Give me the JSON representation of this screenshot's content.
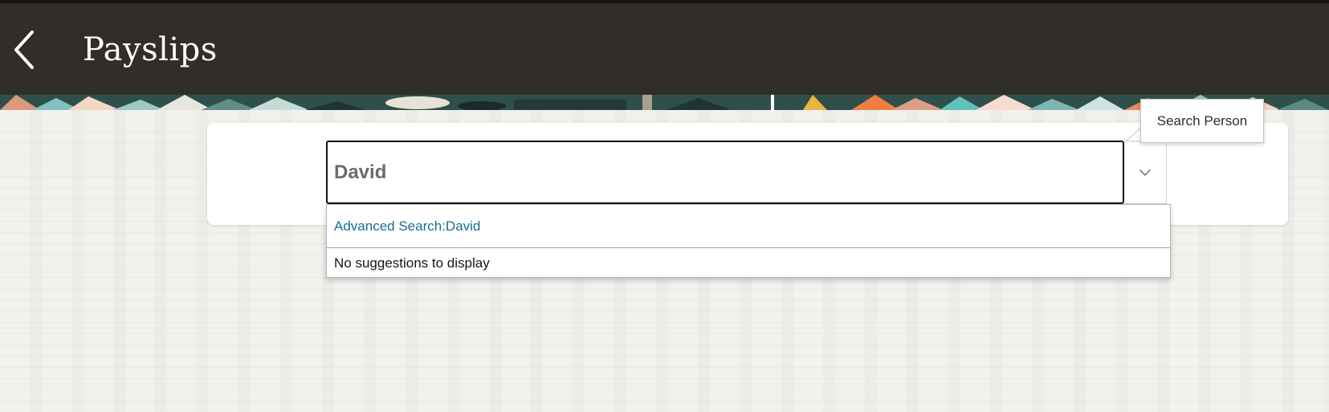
{
  "header": {
    "title": "Payslips",
    "back_icon": "chevron-left-icon"
  },
  "search": {
    "value": "David",
    "dropdown_icon": "chevron-down-icon",
    "tooltip": "Search Person"
  },
  "suggestions": {
    "advanced_search": "Advanced Search:David",
    "empty_message": "No suggestions to display"
  },
  "colors": {
    "header_bg": "#312d2a",
    "link": "#1b6e8d"
  }
}
